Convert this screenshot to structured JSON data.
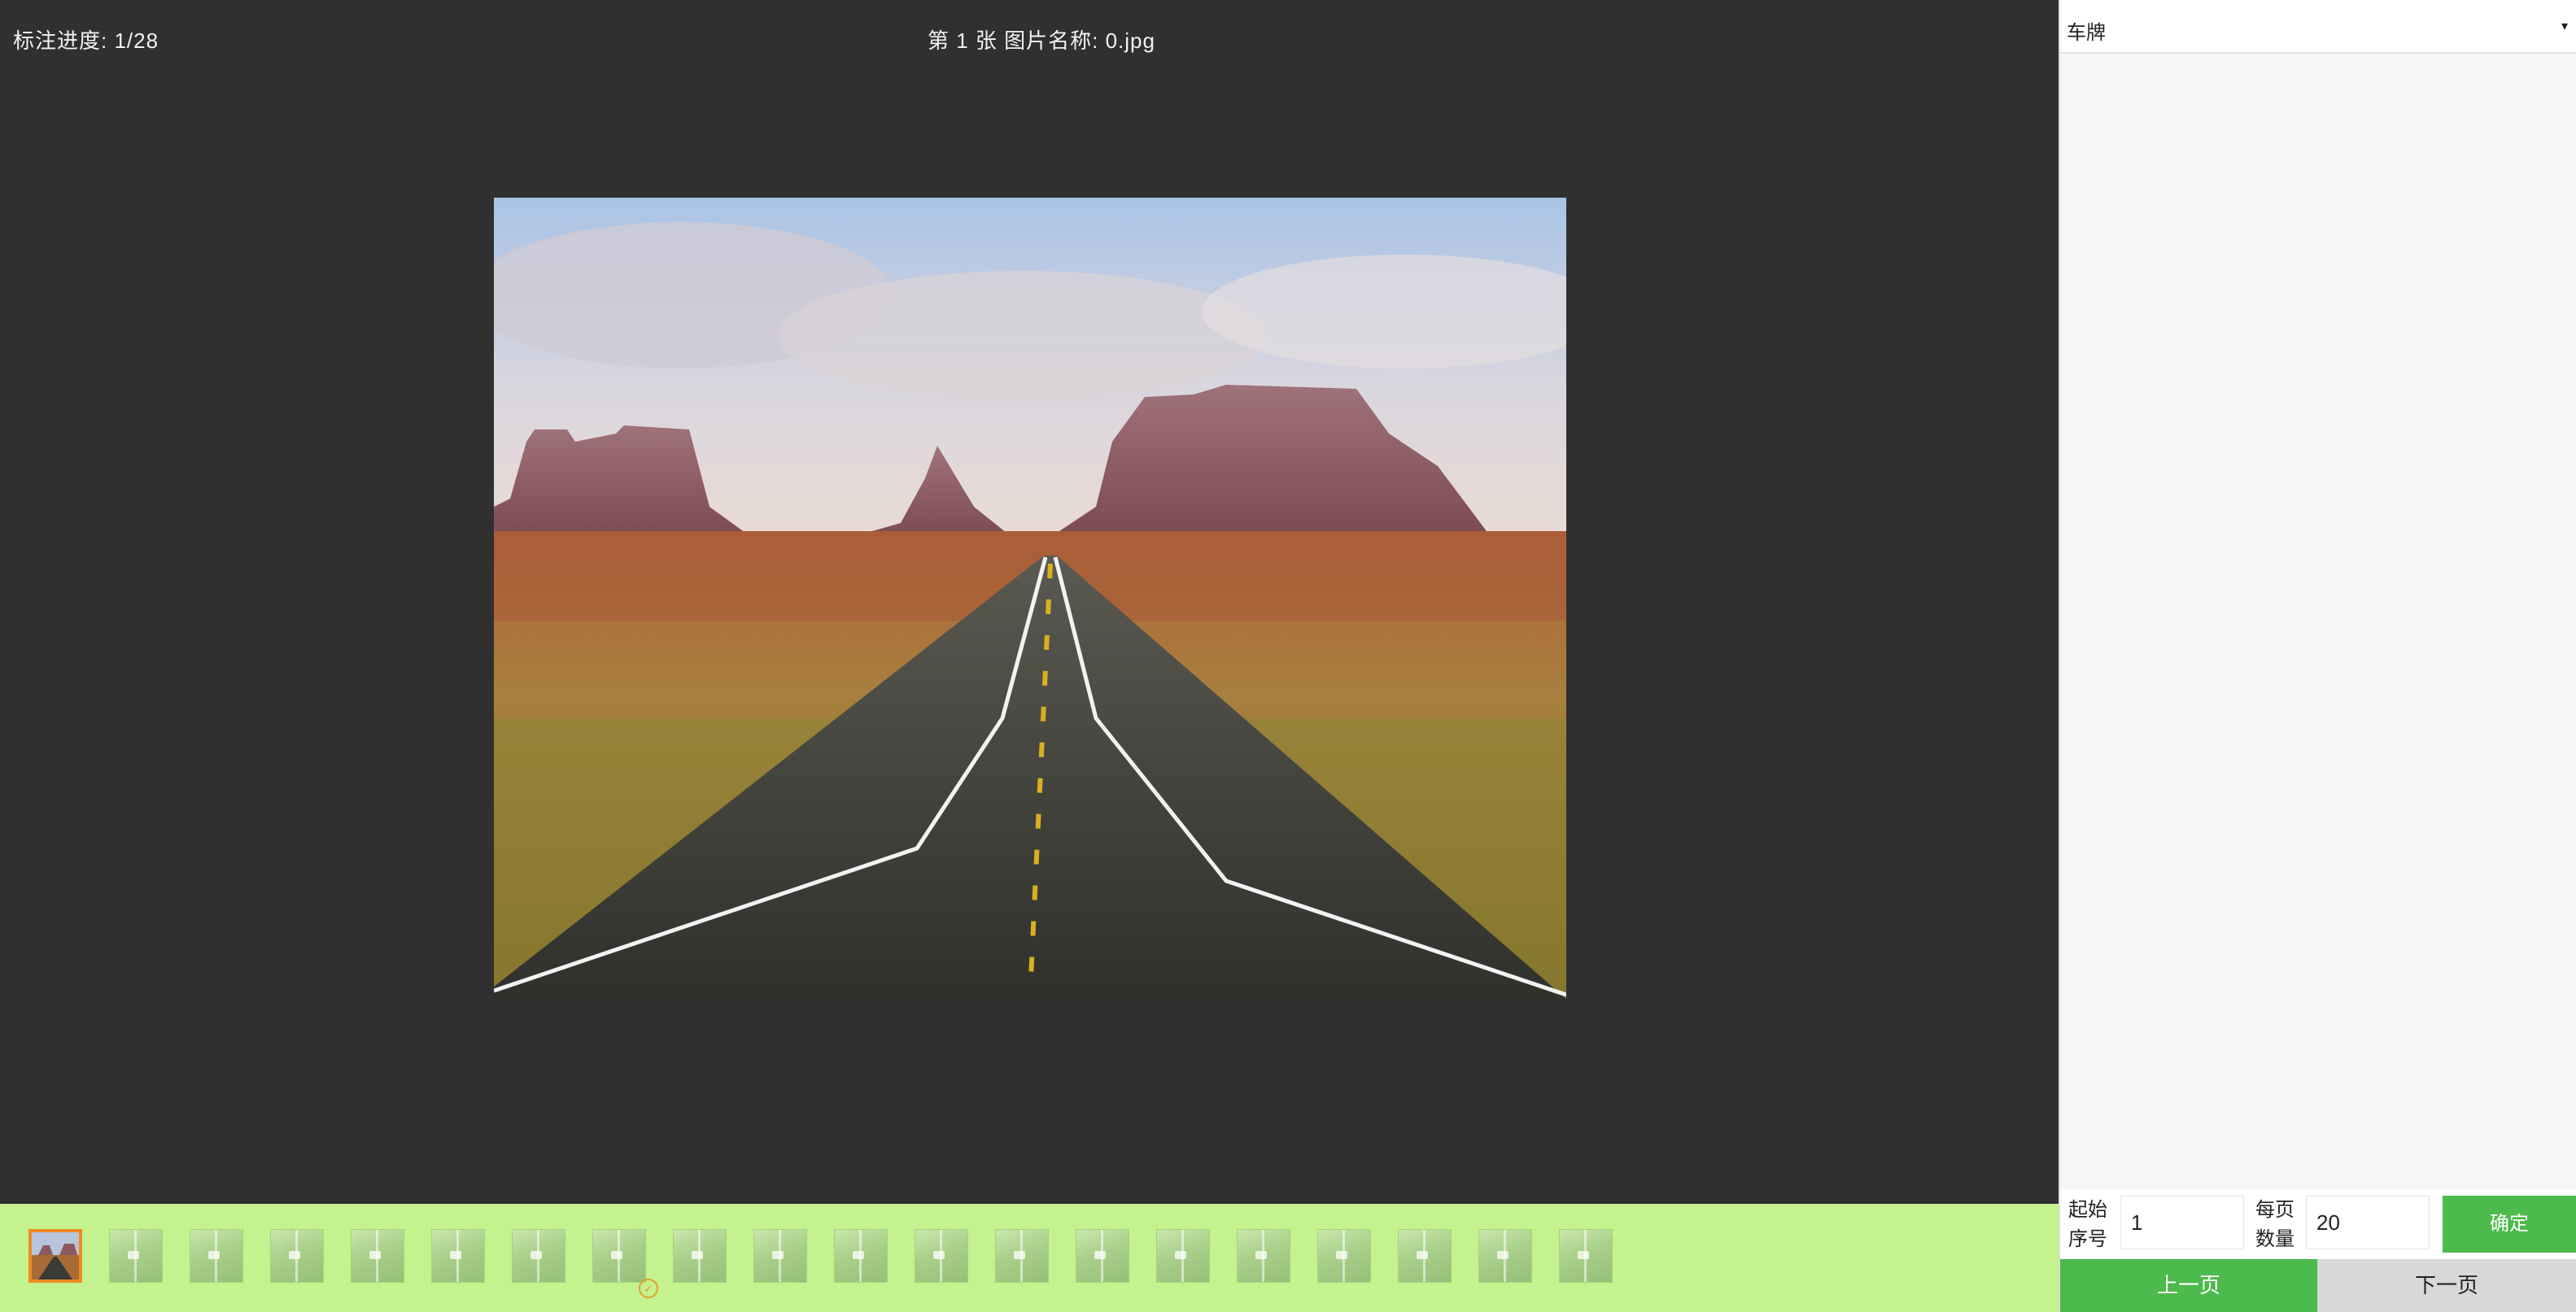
{
  "viewer": {
    "progress_label": "标注进度: 1/28",
    "image_title": "第 1 张 图片名称: 0.jpg",
    "background_color": "#303030"
  },
  "thumbnails": {
    "count": 20,
    "active_index": 0,
    "annotated_icon": "check-circle-icon",
    "strip_color": "#c3f28e",
    "active_border_color": "#f08a24"
  },
  "side_panel": {
    "label_select": {
      "value": "车牌",
      "arrow_icon": "▾"
    },
    "paging": {
      "start_index_label_line1": "起始",
      "start_index_label_line2": "序号",
      "start_index_value": "1",
      "page_size_label_line1": "每页",
      "page_size_label_line2": "数量",
      "page_size_value": "20",
      "confirm_label": "确定",
      "prev_label": "上一页",
      "next_label": "下一页",
      "accent_color": "#4cba4c"
    }
  }
}
